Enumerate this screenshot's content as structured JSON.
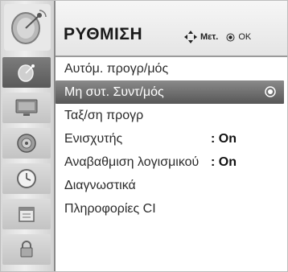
{
  "header": {
    "title": "ΡΥΘΜΙΣΗ",
    "hint_move": "Μετ.",
    "hint_ok": "OK"
  },
  "sidebar": {
    "items": [
      {
        "icon": "satellite-dish-icon",
        "active": true
      },
      {
        "icon": "tv-screen-icon",
        "active": false
      },
      {
        "icon": "speaker-icon",
        "active": false
      },
      {
        "icon": "clock-icon",
        "active": false
      },
      {
        "icon": "calendar-icon",
        "active": false
      },
      {
        "icon": "lock-icon",
        "active": false
      }
    ]
  },
  "menu": {
    "items": [
      {
        "label": "Αυτόμ. προγρ/μός",
        "value": "",
        "selected": false
      },
      {
        "label": "Μη συτ. Συντ/μός",
        "value": "",
        "selected": true
      },
      {
        "label": "Ταξ/ση προγρ",
        "value": "",
        "selected": false
      },
      {
        "label": "Ενισχυτής",
        "value": ": On",
        "selected": false
      },
      {
        "label": "Αναβαθμιση λογισμικού",
        "value": ": On",
        "selected": false
      },
      {
        "label": "Διαγνωστικά",
        "value": "",
        "selected": false
      },
      {
        "label": "Πληροφορίες CI",
        "value": "",
        "selected": false
      }
    ]
  },
  "colors": {
    "selected_bg": "#6e6e6e",
    "text": "#2b2b2b",
    "header_bg": "#eeeeee"
  }
}
